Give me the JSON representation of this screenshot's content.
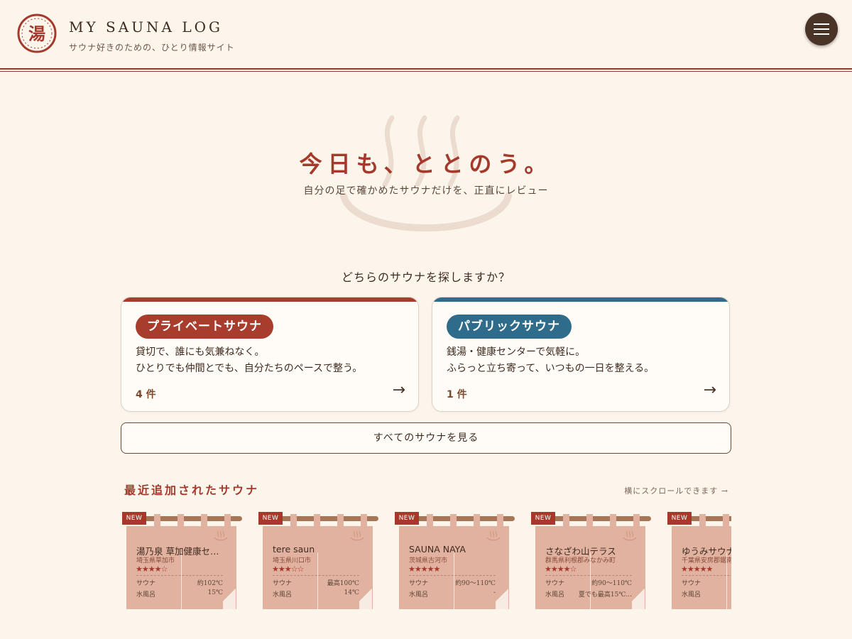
{
  "header": {
    "logo_glyph": "湯",
    "title": "MY SAUNA LOG",
    "tagline": "サウナ好きのための、ひとり情報サイト"
  },
  "hero": {
    "title": "今日も、ととのう。",
    "subtitle": "自分の足で確かめたサウナだけを、正直にレビュー"
  },
  "question": "どちらのサウナを探しますか？",
  "categories": [
    {
      "label": "プライベートサウナ",
      "desc1": "貸切で、誰にも気兼ねなく。",
      "desc2": "ひとりでも仲間とでも、自分たちのペースで整う。",
      "count": "4 件",
      "arrow": "→",
      "color": "#a83d2e"
    },
    {
      "label": "パブリックサウナ",
      "desc1": "銭湯・健康センターで気軽に。",
      "desc2": "ふらっと立ち寄って、いつもの一日を整える。",
      "count": "1 件",
      "arrow": "→",
      "color": "#2f6b8a"
    }
  ],
  "all_button": "すべてのサウナを見る",
  "recent": {
    "title": "最近追加されたサウナ",
    "hint": "横にスクロールできます →",
    "items": [
      {
        "badge": "NEW",
        "name": "湯乃泉 草加健康センター",
        "location": "埼玉県草加市",
        "stars": "★★★★☆",
        "sauna_label": "サウナ",
        "sauna_temp": "約102℃",
        "water_label": "水風呂",
        "water_temp": "15℃"
      },
      {
        "badge": "NEW",
        "name": "tere saun",
        "location": "埼玉県川口市",
        "stars": "★★★☆☆",
        "sauna_label": "サウナ",
        "sauna_temp": "最高100℃",
        "water_label": "水風呂",
        "water_temp": "14℃"
      },
      {
        "badge": "NEW",
        "name": "SAUNA NAYA",
        "location": "茨城県古河市",
        "stars": "★★★★★",
        "sauna_label": "サウナ",
        "sauna_temp": "約90～110℃",
        "water_label": "水風呂",
        "water_temp": "-"
      },
      {
        "badge": "NEW",
        "name": "さなざわ山テラス",
        "location": "群馬県利根郡みなかみ町",
        "stars": "★★★★☆",
        "sauna_label": "サウナ",
        "sauna_temp": "約90～110℃",
        "water_label": "水風呂",
        "water_temp": "夏でも最高15℃..."
      },
      {
        "badge": "NEW",
        "name": "ゆうみサウナ",
        "location": "千葉県安房郡鋸南町",
        "stars": "★★★★★",
        "sauna_label": "サウナ",
        "sauna_temp": "",
        "water_label": "水風呂",
        "water_temp": ""
      }
    ]
  },
  "colors": {
    "accent": "#a53a2c",
    "background": "#fcf5ec",
    "noren": "#e2b2a0",
    "menu": "#4a3428"
  },
  "icons": {
    "menu": "hamburger-icon",
    "logo": "yu-seal-logo",
    "steam": "steam-icon"
  }
}
